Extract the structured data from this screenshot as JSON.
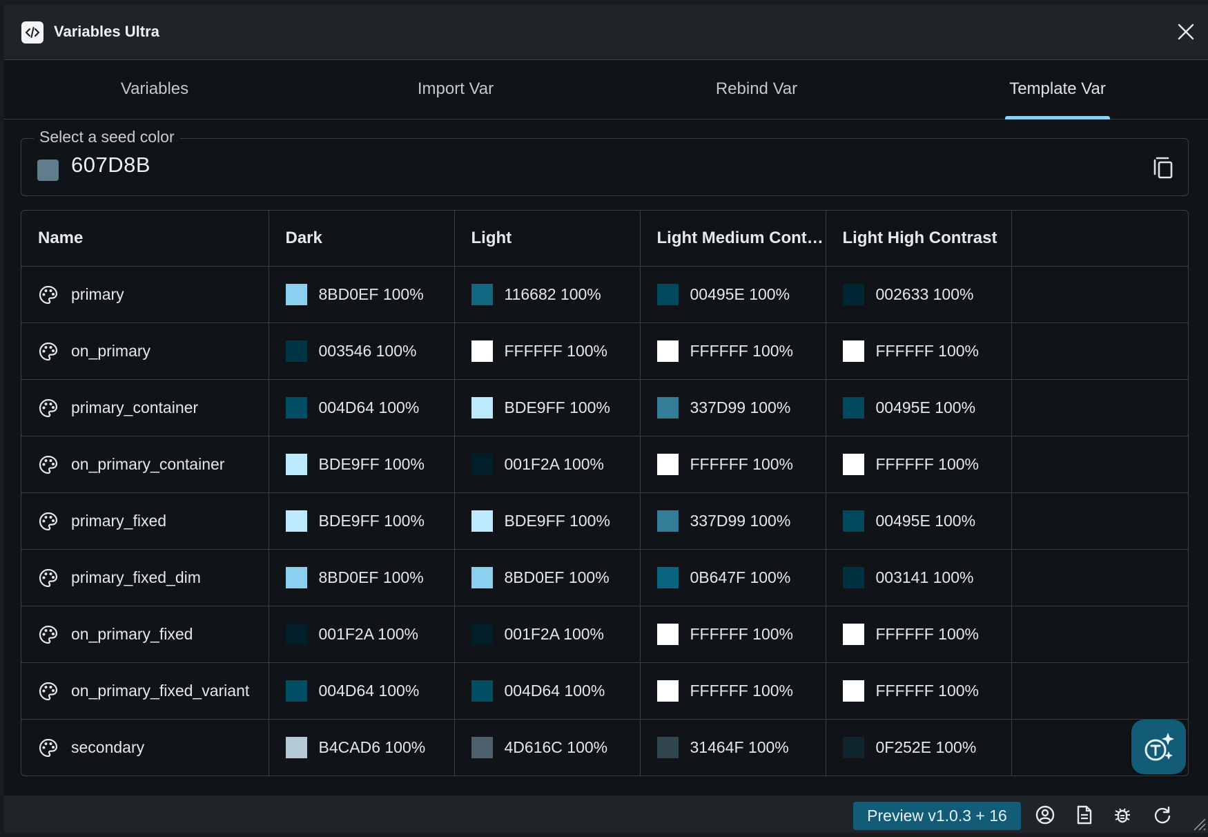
{
  "app": {
    "title": "Variables Ultra"
  },
  "tabs": [
    {
      "label": "Variables",
      "active": false
    },
    {
      "label": "Import Var",
      "active": false
    },
    {
      "label": "Rebind Var",
      "active": false
    },
    {
      "label": "Template Var",
      "active": true
    }
  ],
  "seed": {
    "legend": "Select a seed color",
    "value": "607D8B",
    "color": "#607D8B"
  },
  "table": {
    "columns": [
      "Name",
      "Dark",
      "Light",
      "Light Medium Contr...",
      "Light High Contrast",
      ""
    ],
    "rows": [
      {
        "name": "primary",
        "dark": "8BD0EF 100%",
        "light": "116682 100%",
        "lmc": "00495E 100%",
        "lhc": "002633 100%",
        "dark_color": "#8BD0EF",
        "light_color": "#116682",
        "lmc_color": "#00495E",
        "lhc_color": "#002633"
      },
      {
        "name": "on_primary",
        "dark": "003546 100%",
        "light": "FFFFFF 100%",
        "lmc": "FFFFFF 100%",
        "lhc": "FFFFFF 100%",
        "dark_color": "#003546",
        "light_color": "#FFFFFF",
        "lmc_color": "#FFFFFF",
        "lhc_color": "#FFFFFF"
      },
      {
        "name": "primary_container",
        "dark": "004D64 100%",
        "light": "BDE9FF 100%",
        "lmc": "337D99 100%",
        "lhc": "00495E 100%",
        "dark_color": "#004D64",
        "light_color": "#BDE9FF",
        "lmc_color": "#337D99",
        "lhc_color": "#00495E"
      },
      {
        "name": "on_primary_container",
        "dark": "BDE9FF 100%",
        "light": "001F2A 100%",
        "lmc": "FFFFFF 100%",
        "lhc": "FFFFFF 100%",
        "dark_color": "#BDE9FF",
        "light_color": "#001F2A",
        "lmc_color": "#FFFFFF",
        "lhc_color": "#FFFFFF"
      },
      {
        "name": "primary_fixed",
        "dark": "BDE9FF 100%",
        "light": "BDE9FF 100%",
        "lmc": "337D99 100%",
        "lhc": "00495E 100%",
        "dark_color": "#BDE9FF",
        "light_color": "#BDE9FF",
        "lmc_color": "#337D99",
        "lhc_color": "#00495E"
      },
      {
        "name": "primary_fixed_dim",
        "dark": "8BD0EF 100%",
        "light": "8BD0EF 100%",
        "lmc": "0B647F 100%",
        "lhc": "003141 100%",
        "dark_color": "#8BD0EF",
        "light_color": "#8BD0EF",
        "lmc_color": "#0B647F",
        "lhc_color": "#003141"
      },
      {
        "name": "on_primary_fixed",
        "dark": "001F2A 100%",
        "light": "001F2A 100%",
        "lmc": "FFFFFF 100%",
        "lhc": "FFFFFF 100%",
        "dark_color": "#001F2A",
        "light_color": "#001F2A",
        "lmc_color": "#FFFFFF",
        "lhc_color": "#FFFFFF"
      },
      {
        "name": "on_primary_fixed_variant",
        "dark": "004D64 100%",
        "light": "004D64 100%",
        "lmc": "FFFFFF 100%",
        "lhc": "FFFFFF 100%",
        "dark_color": "#004D64",
        "light_color": "#004D64",
        "lmc_color": "#FFFFFF",
        "lhc_color": "#FFFFFF"
      },
      {
        "name": "secondary",
        "dark": "B4CAD6 100%",
        "light": "4D616C 100%",
        "lmc": "31464F 100%",
        "lhc": "0F252E 100%",
        "dark_color": "#B4CAD6",
        "light_color": "#4D616C",
        "lmc_color": "#31464F",
        "lhc_color": "#0F252E"
      }
    ]
  },
  "statusbar": {
    "version": "Preview v1.0.3 + 16",
    "icons": [
      "account-icon",
      "document-icon",
      "bug-icon",
      "refresh-icon"
    ]
  },
  "colors": {
    "accent": "#8BD0EF",
    "badge": "#125C78"
  }
}
